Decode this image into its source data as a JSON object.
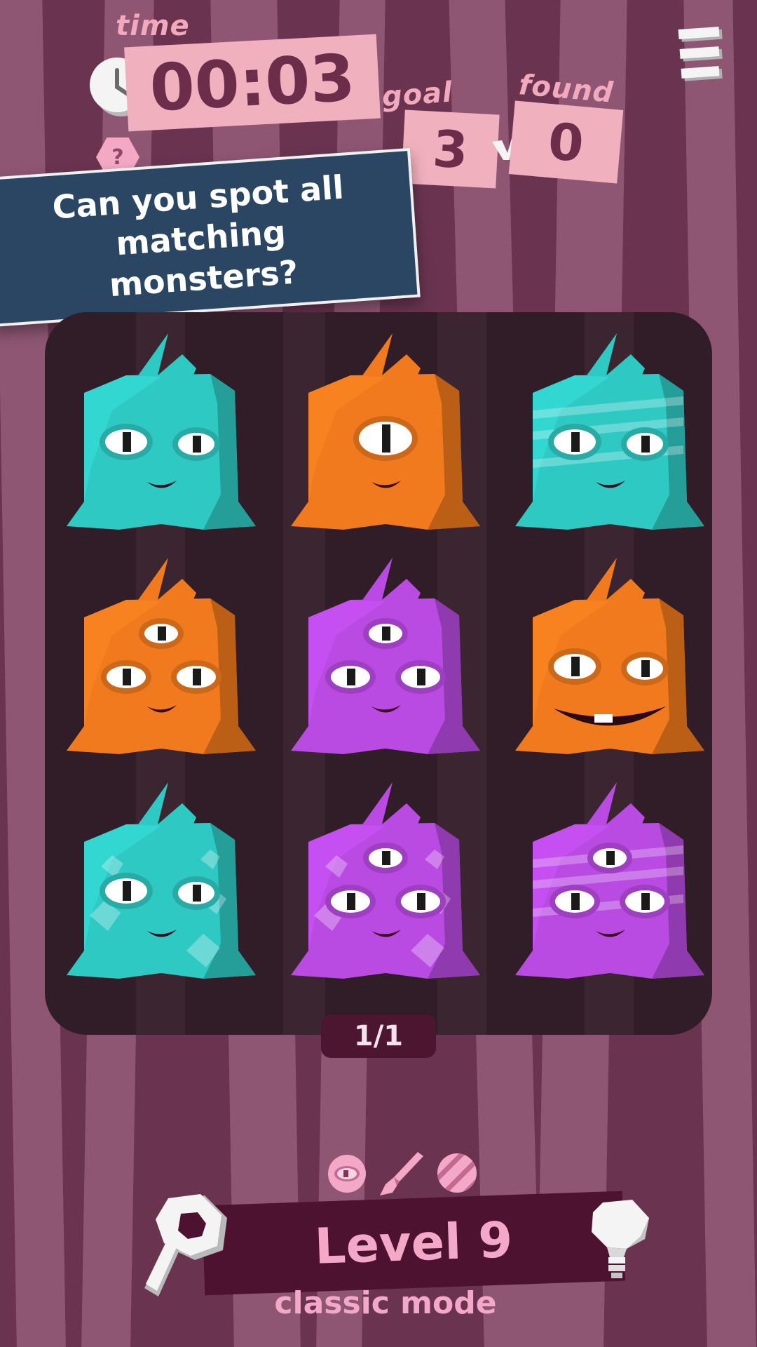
{
  "hud": {
    "time_label": "time",
    "time_value": "00:03",
    "goal_label": "goal",
    "goal_value": "3",
    "found_label": "found",
    "found_value": "0",
    "help_symbol": "?"
  },
  "prompt": "Can you spot all matching monsters?",
  "board": {
    "monsters": [
      {
        "color": "#2fc9c4",
        "eyes": 2,
        "pattern": "none"
      },
      {
        "color": "#f07a1d",
        "eyes": 1,
        "pattern": "none"
      },
      {
        "color": "#2fc9c4",
        "eyes": 2,
        "pattern": "stripes"
      },
      {
        "color": "#f07a1d",
        "eyes": 3,
        "pattern": "none"
      },
      {
        "color": "#b94ae2",
        "eyes": 3,
        "pattern": "none"
      },
      {
        "color": "#f07a1d",
        "eyes": 2,
        "pattern": "big-mouth"
      },
      {
        "color": "#2fc9c4",
        "eyes": 2,
        "pattern": "spots"
      },
      {
        "color": "#b94ae2",
        "eyes": 3,
        "pattern": "spots"
      },
      {
        "color": "#b94ae2",
        "eyes": 3,
        "pattern": "stripes"
      }
    ],
    "pager": "1/1"
  },
  "tools": {
    "icons": [
      "eye-icon",
      "brush-icon",
      "striped-pattern-icon",
      "magnifier-icon",
      "lightbulb-icon"
    ]
  },
  "level": {
    "title": "Level 9",
    "mode": "classic mode"
  },
  "colors": {
    "background": "#6a3450",
    "plate": "#f1b0bd",
    "banner": "#2b4662",
    "board": "#301d28",
    "level_banner": "#4c1230",
    "accent_pink": "#f4a8c8"
  }
}
